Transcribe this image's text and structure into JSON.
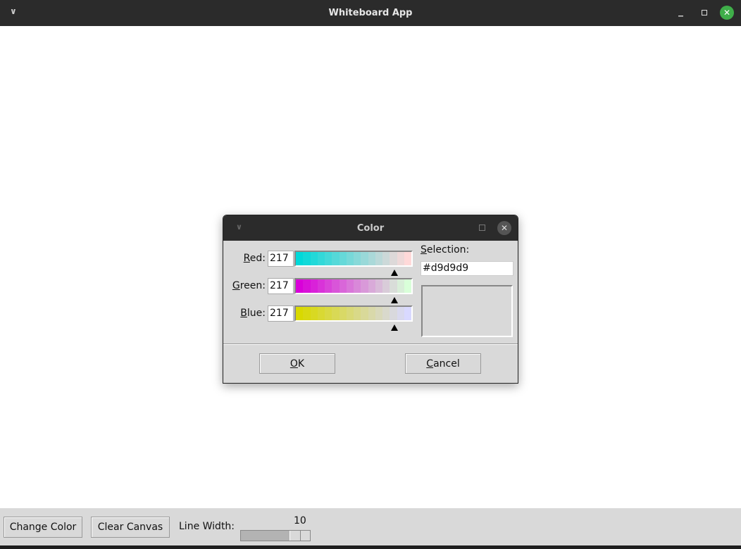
{
  "window": {
    "title": "Whiteboard App",
    "menu_icon": "chevron-down-icon",
    "minimize_icon": "minimize-icon",
    "maximize_icon": "maximize-icon",
    "close_icon": "close-icon",
    "close_color": "#3fae49"
  },
  "toolbar": {
    "change_color_label": "Change Color",
    "clear_canvas_label": "Clear Canvas",
    "line_width_label": "Line Width:",
    "line_width_value": "10",
    "line_width_range": [
      1,
      10
    ]
  },
  "color_dialog": {
    "title": "Color",
    "channels": [
      {
        "label": "Red:",
        "underline": "R",
        "rest": "ed:",
        "value": "217"
      },
      {
        "label": "Green:",
        "underline": "G",
        "rest": "reen:",
        "value": "217"
      },
      {
        "label": "Blue:",
        "underline": "B",
        "rest": "lue:",
        "value": "217"
      }
    ],
    "selection_label_u": "S",
    "selection_label_rest": "election:",
    "selection_value": "#d9d9d9",
    "swatch_color": "#d9d9d9",
    "ok_u": "O",
    "ok_rest": "K",
    "cancel_u": "C",
    "cancel_rest": "ancel"
  }
}
